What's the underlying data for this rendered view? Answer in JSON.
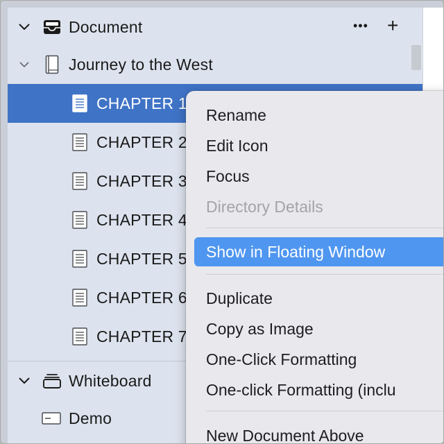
{
  "sidebar": {
    "document_group": {
      "label": "Document"
    },
    "book": {
      "label": "Journey to the West"
    },
    "chapters": [
      {
        "label": "CHAPTER 1"
      },
      {
        "label": "CHAPTER 2"
      },
      {
        "label": "CHAPTER 3"
      },
      {
        "label": "CHAPTER 4"
      },
      {
        "label": "CHAPTER 5"
      },
      {
        "label": "CHAPTER 6"
      },
      {
        "label": "CHAPTER 7"
      }
    ],
    "whiteboard_group": {
      "label": "Whiteboard"
    },
    "whiteboard_items": [
      {
        "label": "Demo"
      }
    ],
    "actions": {
      "more": "•••",
      "add": "+"
    }
  },
  "context_menu": {
    "items": [
      {
        "label": "Rename"
      },
      {
        "label": "Edit Icon"
      },
      {
        "label": "Focus"
      },
      {
        "label": "Directory Details"
      },
      {
        "label": "Show in Floating Window"
      },
      {
        "label": "Duplicate"
      },
      {
        "label": "Copy as Image"
      },
      {
        "label": "One-Click Formatting"
      },
      {
        "label": "One-click Formatting (inclu"
      },
      {
        "label": "New Document Above"
      }
    ]
  },
  "colors": {
    "selection": "#3f73c6",
    "menu_highlight": "#4f96f0",
    "sidebar_bg": "#dde3ee"
  }
}
